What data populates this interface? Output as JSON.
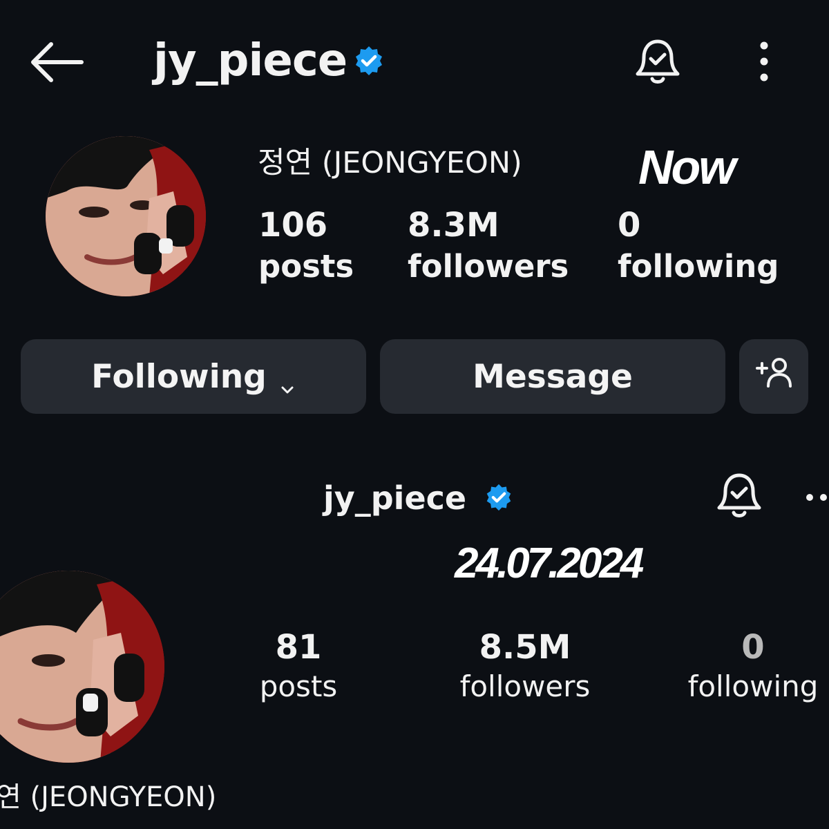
{
  "top": {
    "username": "jy_piece",
    "display_name": "정연 (JEONGYEON)",
    "overlay_label": "Now",
    "stats": [
      {
        "value": "106",
        "label": "posts"
      },
      {
        "value": "8.3M",
        "label": "followers"
      },
      {
        "value": "0",
        "label": "following"
      }
    ],
    "buttons": {
      "following": "Following",
      "message": "Message"
    },
    "icons": {
      "back": "back-arrow-icon",
      "verified": "verified-badge-icon",
      "bell": "notification-bell-icon",
      "more": "more-vertical-icon",
      "chevron": "chevron-down-icon",
      "add_user": "add-user-icon"
    }
  },
  "bottom": {
    "username": "jy_piece",
    "overlay_date": "24.07.2024",
    "display_name": "연 (JEONGYEON)",
    "stats": [
      {
        "value": "81",
        "label": "posts"
      },
      {
        "value": "8.5M",
        "label": "followers"
      },
      {
        "value": "0",
        "label": "following"
      }
    ]
  },
  "colors": {
    "background": "#0c0f14",
    "button": "#262a31",
    "verified": "#1d9bf0",
    "text": "#f2f2f2"
  }
}
